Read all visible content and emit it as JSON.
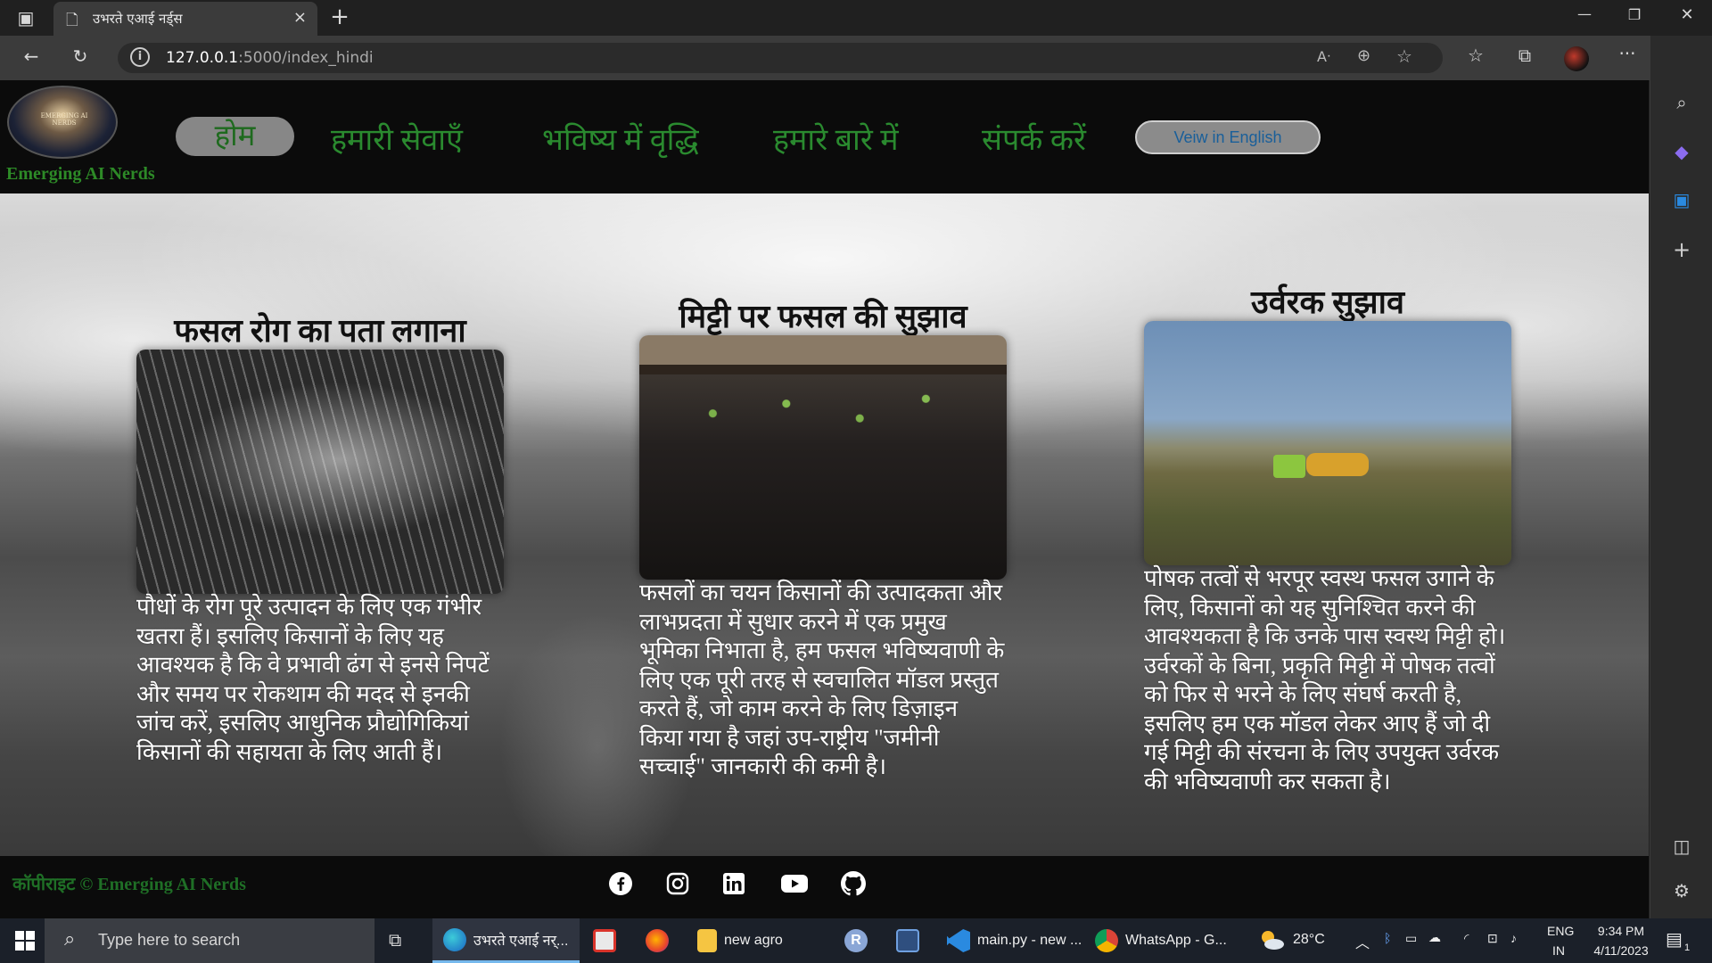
{
  "browser": {
    "tab_title": "उभरते एआई नर्ड्स",
    "url_host": "127.0.0.1",
    "url_path": ":5000/index_hindi",
    "new_tab_symbol": "+",
    "close_symbol": "×",
    "more_symbol": "···"
  },
  "window_controls": {
    "minimize": "—",
    "restore": "❐",
    "close": "✕"
  },
  "site": {
    "logo_text": "EMERGING AI NERDS",
    "brand": "Emerging AI Nerds",
    "nav": {
      "home": "होम",
      "services": "हमारी सेवाएँ",
      "future_growth": "भविष्य में वृद्धि",
      "about": "हमारे बारे में",
      "contact": "संपर्क करें",
      "english_button": "Veiw in English"
    },
    "cards": [
      {
        "title": "फसल रोग का पता लगाना",
        "text": "पौधों के रोग पूरे उत्पादन के लिए एक गंभीर खतरा हैं। इसलिए किसानों के लिए यह आवश्यक है कि वे प्रभावी ढंग से इनसे निपटें और समय पर रोकथाम की मदद से इनकी जांच करें, इसलिए आधुनिक प्रौद्योगिकियां किसानों की सहायता के लिए आती हैं।"
      },
      {
        "title": "मिट्टी पर फसल की सुझाव",
        "text": "फसलों का चयन किसानों की उत्पादकता और लाभप्रदता में सुधार करने में एक प्रमुख भूमिका निभाता है, हम फसल भविष्यवाणी के लिए एक पूरी तरह से स्वचालित मॉडल प्रस्तुत करते हैं, जो काम करने के लिए डिज़ाइन किया गया है जहां उप-राष्ट्रीय \"जमीनी सच्चाई\" जानकारी की कमी है।"
      },
      {
        "title": "उर्वरक सुझाव",
        "text": "पोषक तत्वों से भरपूर स्वस्थ फसल उगाने के लिए, किसानों को यह सुनिश्चित करने की आवश्यकता है कि उनके पास स्वस्थ मिट्टी हो। उर्वरकों के बिना, प्रकृति मिट्टी में पोषक तत्वों को फिर से भरने के लिए संघर्ष करती है, इसलिए हम एक मॉडल लेकर आए हैं जो दी गई मिट्टी की संरचना के लिए उपयुक्त उर्वरक की भविष्यवाणी कर सकता है।"
      }
    ],
    "footer": {
      "copyright": "कॉपीराइट © Emerging AI Nerds",
      "social_icons": [
        "facebook-icon",
        "instagram-icon",
        "linkedin-icon",
        "youtube-icon",
        "github-icon"
      ]
    }
  },
  "taskbar": {
    "search_placeholder": "Type here to search",
    "apps": {
      "edge_tab": "उभरते एआई नर्...",
      "folder": "new agro",
      "r_letter": "R",
      "vscode": "main.py - new ...",
      "chrome": "WhatsApp - G..."
    },
    "weather": "28°C",
    "lang_top": "ENG",
    "lang_bottom": "IN",
    "time": "9:34 PM",
    "date": "4/11/2023",
    "notification_count": "1"
  },
  "colors": {
    "nav_green": "#2a8a2f",
    "brand_green": "#2d8a27",
    "english_button_text": "#195f9a",
    "taskbar_bg": "#1b2029"
  }
}
